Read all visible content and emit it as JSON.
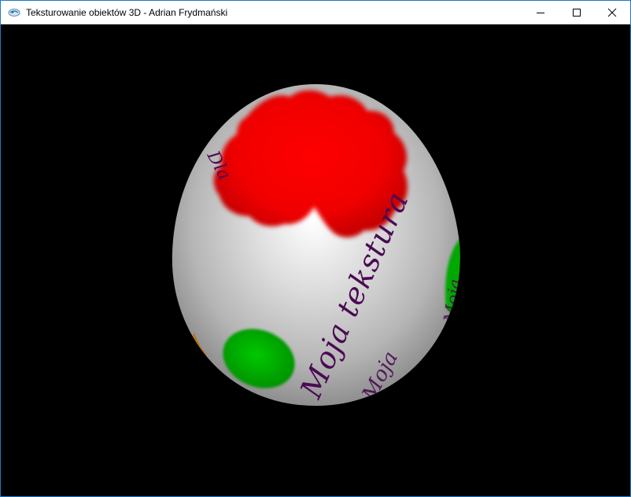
{
  "window": {
    "title": "Teksturowanie obiektów 3D - Adrian Frydmański",
    "controls": {
      "minimize_icon": "minimize-icon",
      "maximize_icon": "maximize-icon",
      "close_icon": "close-icon"
    }
  },
  "scene": {
    "background_color": "#000000",
    "object": "textured-egg",
    "texture_text_main": "Moja tekstura",
    "texture_text_partial_left": "Dla",
    "texture_text_partial_right": "Moja",
    "texture_text_lower": "Moja",
    "colors": {
      "egg_base": "#d8d8d8",
      "red_blob": "#ff0000",
      "green_blob": "#00b000",
      "text": "#4a0a52"
    }
  }
}
